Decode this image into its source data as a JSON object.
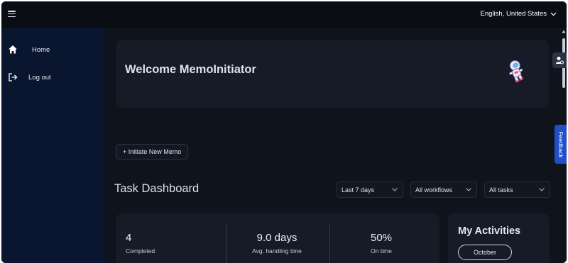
{
  "topbar": {
    "menu_icon": "hamburger-icon",
    "language": "English, United States",
    "language_icon": "chevron-down-icon"
  },
  "sidebar": {
    "items": [
      {
        "label": "Home",
        "icon": "home-icon"
      },
      {
        "label": "Log out",
        "icon": "logout-icon"
      }
    ]
  },
  "welcome": {
    "title": "Welcome MemoInitiator",
    "illustration": "astronaut-icon"
  },
  "actions": {
    "initiate_label": "+ Initiate New Memo"
  },
  "dashboard": {
    "title": "Task Dashboard",
    "filters": {
      "period": "Last 7 days",
      "workflows": "All workflows",
      "tasks": "All tasks"
    },
    "stats": [
      {
        "value": "4",
        "label": "Completed"
      },
      {
        "value": "9.0 days",
        "label": "Avg. handling time"
      },
      {
        "value": "50%",
        "label": "On time"
      }
    ]
  },
  "activities": {
    "title": "My Activities",
    "month": "October"
  },
  "side_tabs": {
    "feedback": "Feedback",
    "user_icon": "user-settings-icon"
  },
  "colors": {
    "background": "#0f131c",
    "sidebar": "#0a1530",
    "card": "#161b27",
    "feedback_tab": "#1f4fc9"
  }
}
